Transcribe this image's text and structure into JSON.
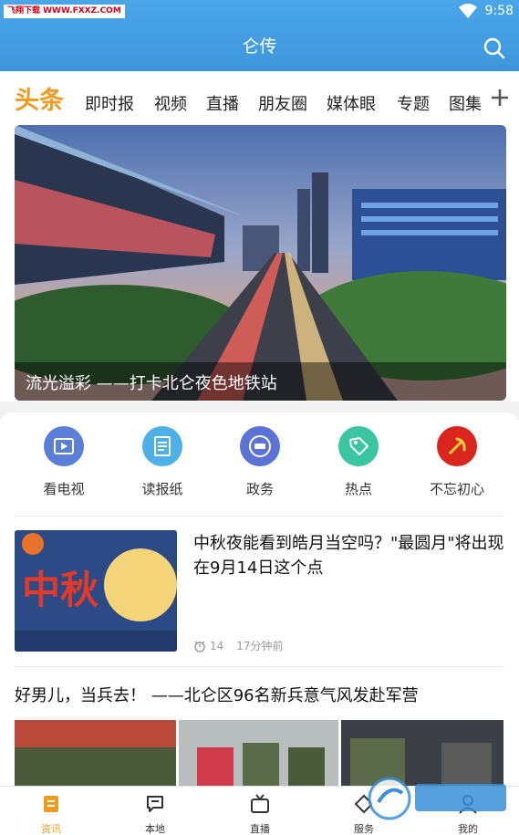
{
  "status": {
    "watermark": "飞翔下载 WWW.FXXZ.COM",
    "time": "9:58"
  },
  "app": {
    "title": "仑传"
  },
  "channels": {
    "head": "头条",
    "items": [
      "即时报",
      "视频",
      "直播",
      "朋友圈",
      "媒体眼",
      "专题",
      "图集"
    ]
  },
  "hero": {
    "caption": "流光溢彩 ——打卡北仑夜色地铁站"
  },
  "quick_links": [
    {
      "label": "看电视",
      "icon": "tv-icon",
      "color": "#5b7fd6"
    },
    {
      "label": "读报纸",
      "icon": "newspaper-icon",
      "color": "#4fb0e8"
    },
    {
      "label": "政务",
      "icon": "government-icon",
      "color": "#5b73d6"
    },
    {
      "label": "热点",
      "icon": "tag-icon",
      "color": "#39c6a0"
    },
    {
      "label": "不忘初心",
      "icon": "party-emblem-icon",
      "color": "#d9251d"
    }
  ],
  "news": [
    {
      "title": "中秋夜能看到皓月当空吗？\"最圆月\"将出现在9月14日这个点",
      "views": "14",
      "time": "17分钟前",
      "thumb_text": "中秋"
    },
    {
      "title": "好男儿，当兵去！ ——北仑区96名新兵意气风发赴军营"
    }
  ],
  "bottom_nav": [
    {
      "label": "资讯",
      "icon": "news-icon",
      "active": true
    },
    {
      "label": "本地",
      "icon": "chat-icon",
      "active": false
    },
    {
      "label": "直播",
      "icon": "tv-live-icon",
      "active": false
    },
    {
      "label": "服务",
      "icon": "service-icon",
      "active": false
    },
    {
      "label": "我的",
      "icon": "profile-icon",
      "active": false
    }
  ],
  "colors": {
    "header": "#3f96dc",
    "accent": "#f29b21"
  }
}
